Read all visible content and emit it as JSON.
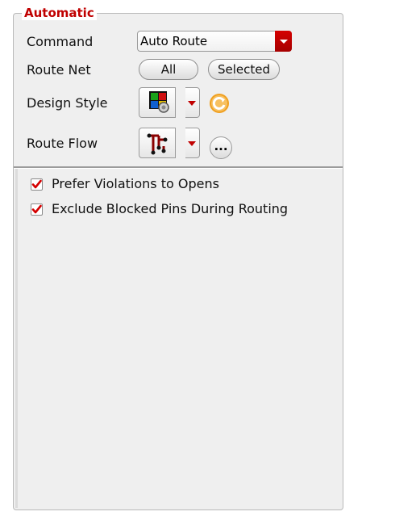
{
  "group": {
    "title": "Automatic"
  },
  "command": {
    "label": "Command",
    "value": "Auto Route"
  },
  "route_net": {
    "label": "Route Net",
    "all_label": "All",
    "selected_label": "Selected"
  },
  "design_style": {
    "label": "Design Style",
    "icon": "design-style-icon",
    "refresh_icon": "refresh-icon"
  },
  "route_flow": {
    "label": "Route Flow",
    "icon": "route-flow-icon",
    "more_label": "..."
  },
  "options": [
    {
      "label": "Prefer Violations to Opens",
      "checked": true
    },
    {
      "label": "Exclude Blocked Pins During Routing",
      "checked": true
    }
  ],
  "colors": {
    "accent": "#c00000",
    "check": "#d40000"
  }
}
